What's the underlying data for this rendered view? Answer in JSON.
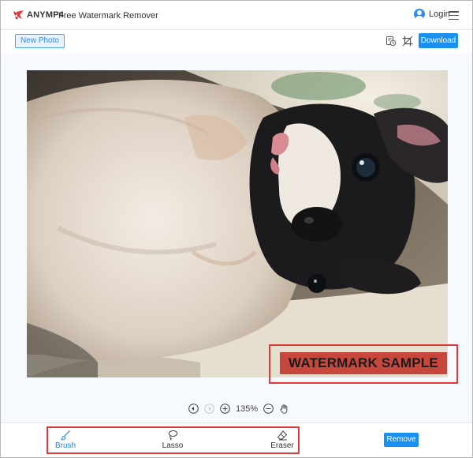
{
  "header": {
    "logo_text": "ANYMP4",
    "app_title": "Free Watermark Remover",
    "login_label": "Login"
  },
  "toolbar": {
    "new_photo_label": "New Photo",
    "download_label": "Download",
    "icons": [
      "history-icon",
      "crop-icon"
    ]
  },
  "canvas": {
    "watermark_text": "WATERMARK SAMPLE",
    "zoom_level": "135%"
  },
  "tools": [
    {
      "label": "Brush",
      "icon": "brush-icon",
      "active": true
    },
    {
      "label": "Lasso",
      "icon": "lasso-icon",
      "active": false
    },
    {
      "label": "Eraser",
      "icon": "eraser-icon",
      "active": false
    }
  ],
  "actions": {
    "remove_label": "Remove"
  },
  "colors": {
    "accent": "#1a8ff2",
    "highlight_border": "#e03a3a"
  }
}
